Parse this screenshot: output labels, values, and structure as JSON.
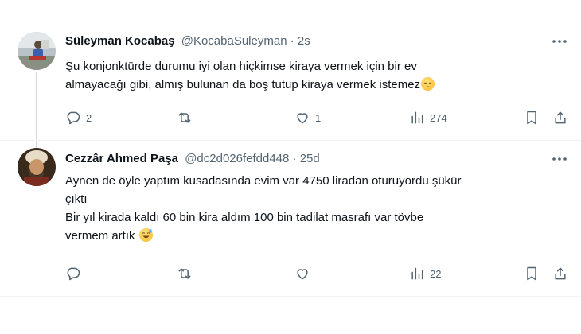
{
  "tweets": [
    {
      "name": "Süleyman Kocabaş",
      "handle": "@KocabaSuleyman",
      "separator": "·",
      "time": "2s",
      "text": [
        "Şu konjonktürde durumu iyi olan hiçkimse kiraya vermek için bir ev",
        "almayacağı gibi, almış bulunan da boş tutup kiraya vermek istemez"
      ],
      "emoji": "pensive-face-emoji",
      "actions": {
        "replies": "2",
        "reposts": "",
        "likes": "1",
        "views": "274"
      }
    },
    {
      "name": "Cezzâr Ahmed Paşa",
      "handle": "@dc2d026fefdd448",
      "separator": "·",
      "time": "25d",
      "text": [
        "Aynen de öyle yaptım kusadasında evim var 4750 liradan oturuyordu şükür",
        "çıktı",
        "Bir yıl kirada kaldı 60 bin kira aldım 100 bin tadilat masrafı var tövbe",
        "vermem artık"
      ],
      "emoji": "grinning-sweat-emoji",
      "actions": {
        "replies": "",
        "reposts": "",
        "likes": "",
        "views": "22"
      }
    }
  ]
}
